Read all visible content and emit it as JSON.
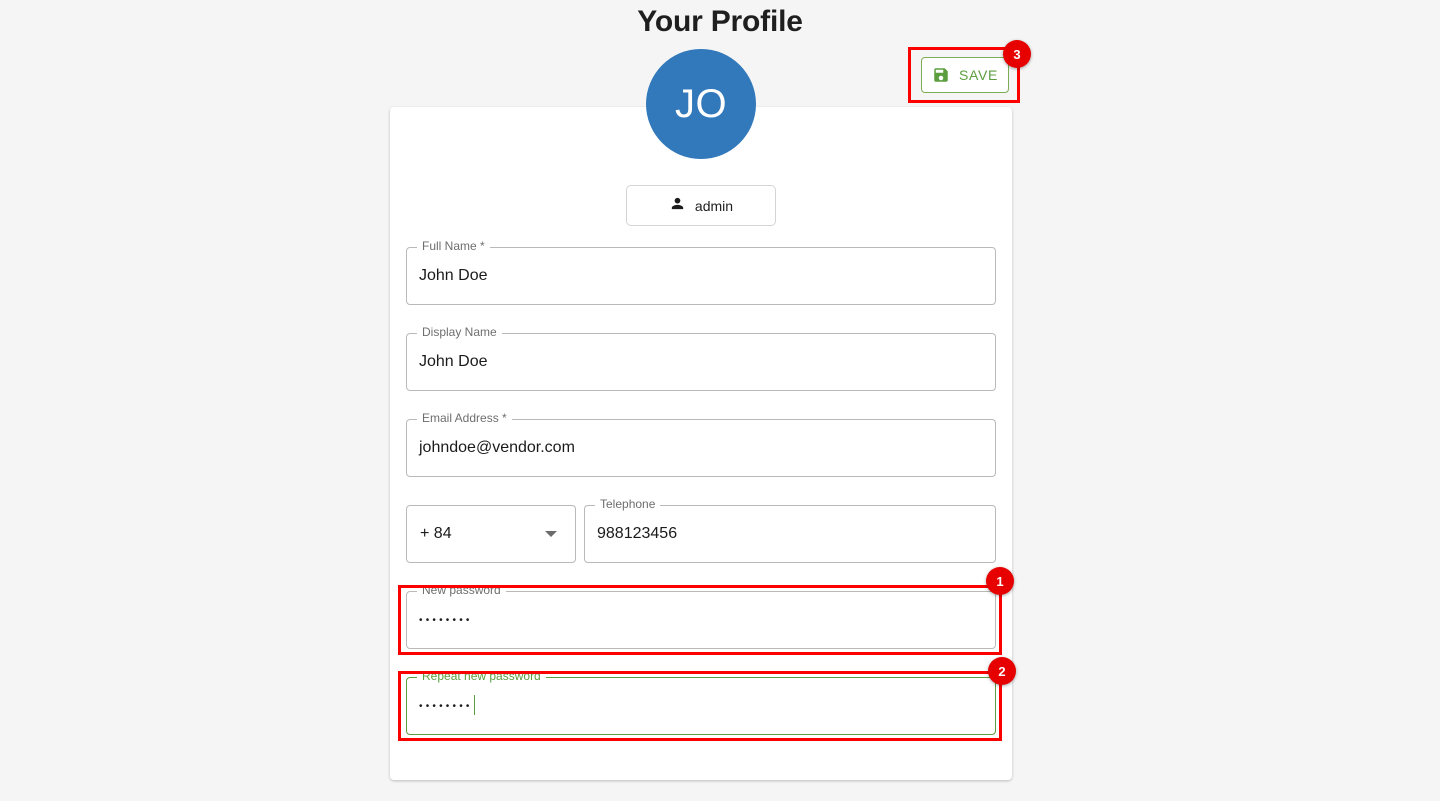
{
  "page": {
    "title": "Your Profile",
    "background_color": "#f5f5f5"
  },
  "toolbar": {
    "save_label": "SAVE",
    "save_icon": "save-floppy-icon",
    "save_color": "#5c9e3f"
  },
  "profile": {
    "avatar_initials": "JO",
    "avatar_color": "#3279bb",
    "role_label": "admin",
    "role_icon": "person-icon"
  },
  "form": {
    "full_name": {
      "label": "Full Name *",
      "value": "John Doe"
    },
    "display_name": {
      "label": "Display Name",
      "value": "John Doe"
    },
    "email": {
      "label": "Email Address *",
      "value": "johndoe@vendor.com"
    },
    "country_code": {
      "value": "+ 84",
      "icon": "chevron-down-icon"
    },
    "telephone": {
      "label": "Telephone",
      "value": "988123456"
    },
    "new_password": {
      "label": "New password",
      "value": "••••••••"
    },
    "repeat_password": {
      "label": "Repeat new password",
      "value": "••••••••",
      "state_color": "#5c9e3f"
    }
  },
  "annotations": {
    "color": "#fc0000",
    "badges": [
      {
        "number": "1"
      },
      {
        "number": "2"
      },
      {
        "number": "3"
      }
    ]
  }
}
